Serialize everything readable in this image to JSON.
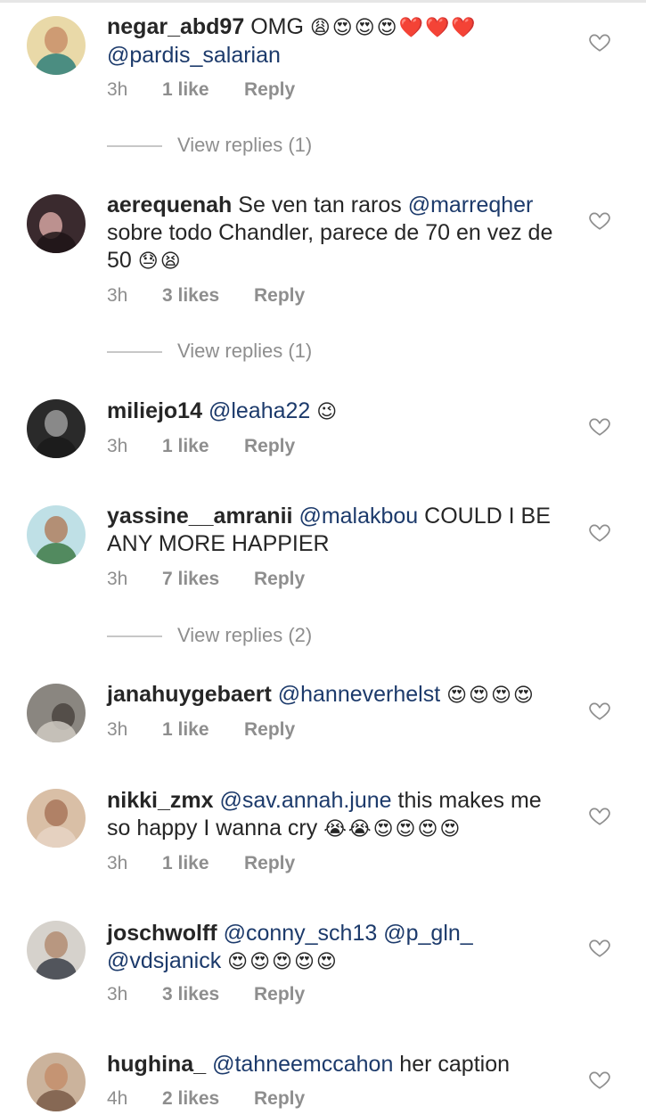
{
  "comments": [
    {
      "username": "negar_abd97",
      "mentions": [],
      "text_before": "OMG ",
      "emoji": "😩😍😍😍❤️❤️❤️",
      "line2_mention": "@pardis_salarian",
      "time": "3h",
      "likes": "1 like",
      "reply": "Reply",
      "view_replies": "View replies (1)",
      "avatar_color": "#c9a23a"
    },
    {
      "username": "aerequenah",
      "text_part1": "Se ven tan raros ",
      "mention": "@marreqher",
      "line2": "sobre todo Chandler, parece de 70 en vez de",
      "line3": "50 ",
      "emoji": "😓😫",
      "time": "3h",
      "likes": "3 likes",
      "reply": "Reply",
      "view_replies": "View replies (1)",
      "avatar_color": "#3a2a2e"
    },
    {
      "username": "miliejo14",
      "mention": "@leaha22",
      "emoji": "😉",
      "time": "3h",
      "likes": "1 like",
      "reply": "Reply",
      "avatar_color": "#5a5a5a"
    },
    {
      "username": "yassine__amranii",
      "mention": "@malakbou",
      "text_after": " COULD I BE",
      "line2": "ANY MORE HAPPIER",
      "time": "3h",
      "likes": "7 likes",
      "reply": "Reply",
      "view_replies": "View replies (2)",
      "avatar_color": "#4f8a5c"
    },
    {
      "username": "janahuygebaert",
      "mention": "@hanneverhelst",
      "emoji": "😍😍😍😍",
      "time": "3h",
      "likes": "1 like",
      "reply": "Reply",
      "avatar_color": "#6b6560"
    },
    {
      "username": "nikki_zmx",
      "mention": "@sav.annah.june",
      "text_after": " this makes me",
      "line2": "so happy I wanna cry ",
      "emoji": "😭😭😍😍😍😍",
      "time": "3h",
      "likes": "1 like",
      "reply": "Reply",
      "avatar_color": "#b58a6a"
    },
    {
      "username": "joschwolff",
      "mention": "@conny_sch13",
      "mention2": "@p_gln_",
      "line2_mention": "@vdsjanick",
      "emoji": "😍😍😍😍😍",
      "time": "3h",
      "likes": "3 likes",
      "reply": "Reply",
      "avatar_color": "#8b7768"
    },
    {
      "username": "hughina_",
      "mention": "@tahneemccahon",
      "text_after": "  her caption",
      "time": "4h",
      "likes": "2 likes",
      "reply": "Reply",
      "avatar_color": "#9a7560"
    }
  ]
}
